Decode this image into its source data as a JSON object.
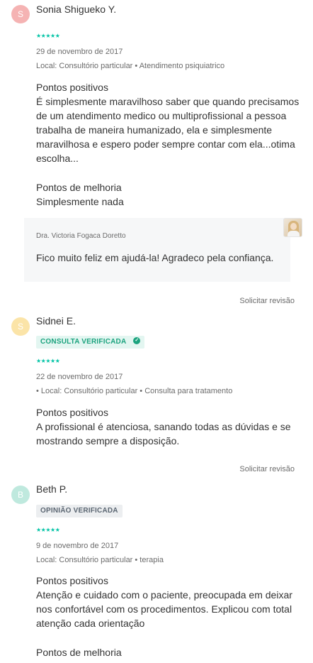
{
  "reviews": [
    {
      "initial": "S",
      "avatar_color": "#f5b3b3",
      "name": "Sonia Shigueko Y.",
      "stars": "★★★★★",
      "date": "29 de novembro de 2017",
      "local": "Local: Consultório particular • Atendimento psiquiatrico",
      "pos_title": "Pontos positivos",
      "pos_text": "É simplesmente maravilhoso saber que quando precisamos de um atendimento medico ou multiprofissional a pessoa trabalha de maneira humanizado, ela e simplesmente maravilhosa e espero poder sempre contar com ela...otima escolha...",
      "neg_title": "Pontos de melhoria",
      "neg_text": "Simplesmente nada",
      "reply": {
        "doctor": "Dra. Victoria Fogaca Doretto",
        "text": "Fico muito feliz em ajudá-la! Agradeco pela confiança."
      },
      "request_label": "Solicitar revisão"
    },
    {
      "initial": "S",
      "avatar_color": "#fbe4a8",
      "name": "Sidnei E.",
      "badge": "CONSULTA VERIFICADA",
      "stars": "★★★★★",
      "date": "22 de novembro de 2017",
      "local": "• Local: Consultório particular • Consulta para tratamento",
      "pos_title": "Pontos positivos",
      "pos_text": "A profissional é atenciosa, sanando todas as dúvidas e se mostrando sempre a disposição.",
      "request_label": "Solicitar revisão"
    },
    {
      "initial": "B",
      "avatar_color": "#bfe9de",
      "name": "Beth P.",
      "badge": "OPINIÃO VERIFICADA",
      "stars": "★★★★★",
      "date": "9 de novembro de 2017",
      "local": "Local: Consultório particular • terapia",
      "pos_title": "Pontos positivos",
      "pos_text": "Atenção e cuidado com o paciente, preocupada em deixar nos confortável com os procedimentos. Explicou com total atenção cada orientação",
      "neg_title": "Pontos de melhoria"
    }
  ]
}
